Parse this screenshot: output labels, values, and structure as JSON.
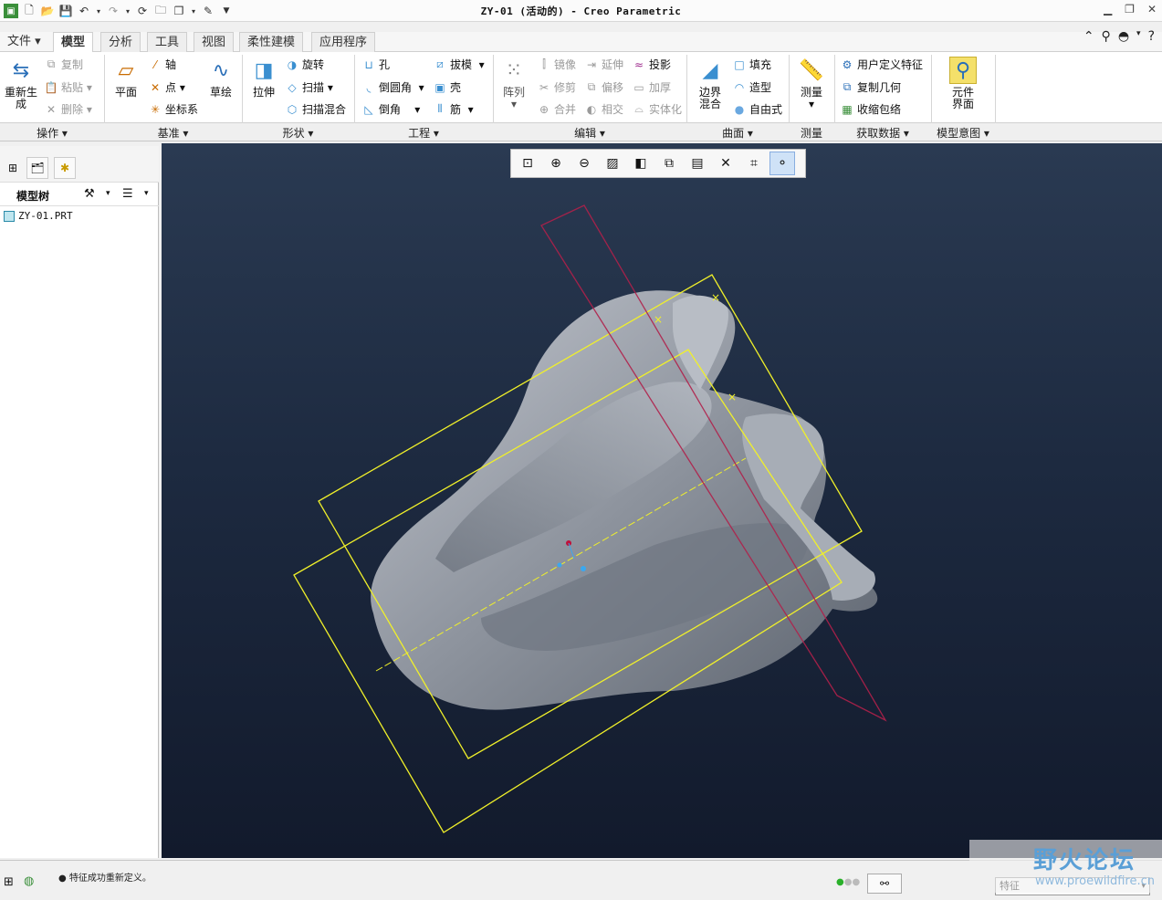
{
  "window": {
    "title": "ZY-01 (活动的) - Creo Parametric"
  },
  "menu": {
    "file": "文件",
    "tabs": [
      "模型",
      "分析",
      "工具",
      "视图",
      "柔性建模",
      "应用程序"
    ]
  },
  "ribbon": {
    "ops": {
      "regen": "重新生成",
      "copy": "复制",
      "paste": "粘贴",
      "delete": "删除"
    },
    "datum": {
      "plane": "平面",
      "axis": "轴",
      "point": "点",
      "csys": "坐标系",
      "sketch": "草绘"
    },
    "shape": {
      "extrude": "拉伸",
      "revolve": "旋转",
      "sweep": "扫描",
      "swept_blend": "扫描混合"
    },
    "eng": {
      "hole": "孔",
      "round": "倒圆角",
      "chamfer": "倒角",
      "draft": "拔模",
      "shell": "壳",
      "rib": "筋"
    },
    "edit": {
      "pattern": "阵列",
      "mirror": "镜像",
      "trim": "修剪",
      "merge": "合并",
      "extend": "延伸",
      "offset": "偏移",
      "intersect": "相交",
      "project": "投影",
      "thicken": "加厚",
      "solidify": "实体化"
    },
    "surf": {
      "boundary_blend": "边界混合",
      "fill": "填充",
      "style": "造型",
      "freestyle": "自由式"
    },
    "measure": {
      "measure": "测量"
    },
    "getdata": {
      "udf": "用户定义特征",
      "copygeom": "复制几何",
      "shrinkwrap": "收缩包络"
    },
    "intent": {
      "component_interface": "元件界面"
    },
    "group_labels": [
      "操作",
      "基准",
      "形状",
      "工程",
      "编辑",
      "曲面",
      "测量",
      "获取数据",
      "模型意图"
    ]
  },
  "tree": {
    "header": "模型树",
    "item": "ZY-01.PRT"
  },
  "status": {
    "message": "特征成功重新定义。",
    "filter": "特征"
  },
  "watermark": {
    "cn": "野火论坛",
    "url": "www.proewildfire.cn"
  },
  "colors": {
    "viewport_top": "#2a3a52",
    "viewport_bottom": "#121a2c",
    "datum_yellow": "#f0f02a",
    "datum_red": "#b0204a",
    "model_gray": "#8e949e"
  }
}
